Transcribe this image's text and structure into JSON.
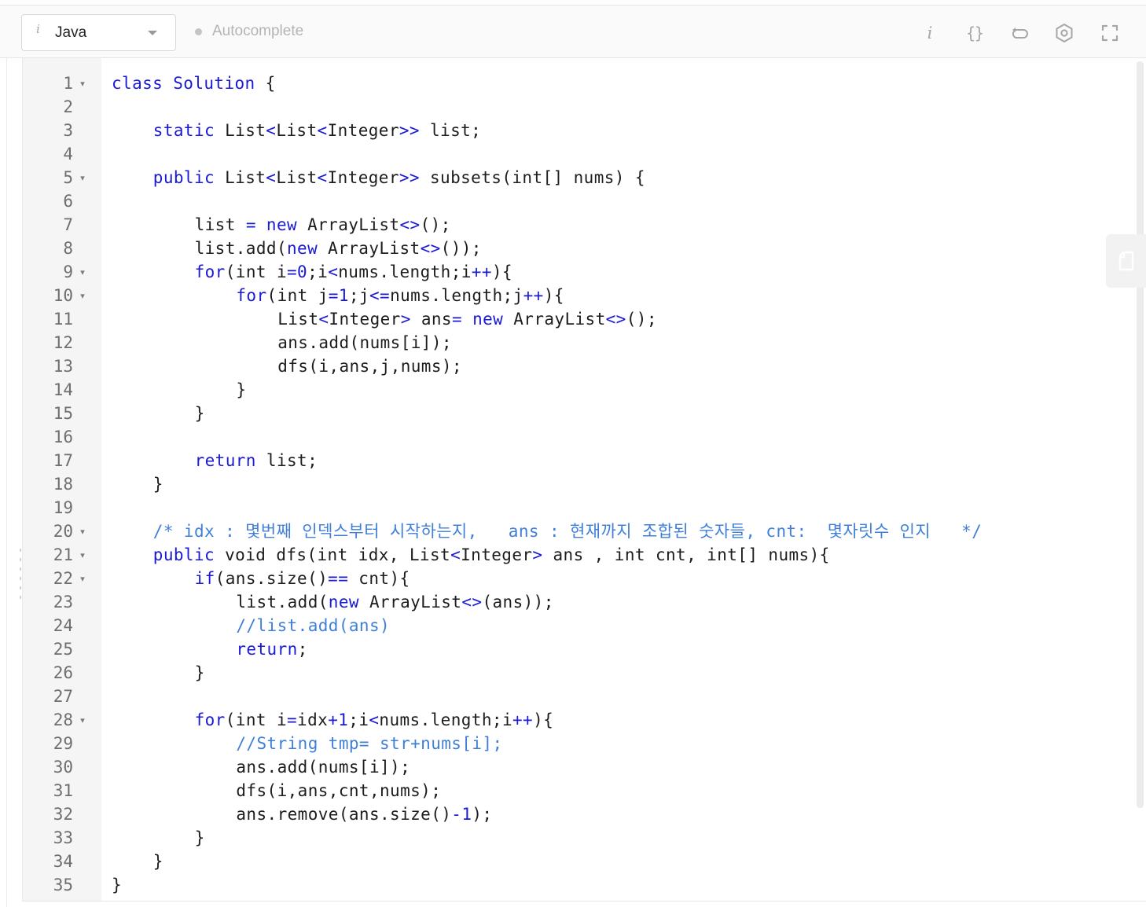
{
  "toolbar": {
    "language": "Java",
    "autocomplete_label": "Autocomplete",
    "icons": [
      "info-icon",
      "format-braces-icon",
      "reset-icon",
      "settings-icon",
      "fullscreen-icon"
    ],
    "info_glyph": "i",
    "braces_glyph": "{}"
  },
  "editor": {
    "lines": [
      {
        "n": "1",
        "fold": true,
        "indent": 0,
        "tokens": [
          [
            "kw",
            "class Solution "
          ],
          [
            "",
            "{"
          ]
        ]
      },
      {
        "n": "2",
        "fold": false,
        "indent": 0,
        "tokens": []
      },
      {
        "n": "3",
        "fold": false,
        "indent": 1,
        "tokens": [
          [
            "kw",
            "static"
          ],
          [
            "",
            " List"
          ],
          [
            "op",
            "<"
          ],
          [
            "",
            "List"
          ],
          [
            "op",
            "<"
          ],
          [
            "",
            "Integer"
          ],
          [
            "op",
            ">>"
          ],
          [
            "",
            " list;"
          ]
        ]
      },
      {
        "n": "4",
        "fold": false,
        "indent": 0,
        "tokens": []
      },
      {
        "n": "5",
        "fold": true,
        "indent": 1,
        "tokens": [
          [
            "kw",
            "public"
          ],
          [
            "",
            " List"
          ],
          [
            "op",
            "<"
          ],
          [
            "",
            "List"
          ],
          [
            "op",
            "<"
          ],
          [
            "",
            "Integer"
          ],
          [
            "op",
            ">>"
          ],
          [
            "",
            " subsets(int[] nums) {"
          ]
        ]
      },
      {
        "n": "6",
        "fold": false,
        "indent": 0,
        "tokens": []
      },
      {
        "n": "7",
        "fold": false,
        "indent": 2,
        "tokens": [
          [
            "",
            "list "
          ],
          [
            "op",
            "="
          ],
          [
            "",
            " "
          ],
          [
            "kw",
            "new"
          ],
          [
            "",
            " ArrayList"
          ],
          [
            "op",
            "<>"
          ],
          [
            "",
            "();"
          ]
        ]
      },
      {
        "n": "8",
        "fold": false,
        "indent": 2,
        "tokens": [
          [
            "",
            "list.add("
          ],
          [
            "kw",
            "new"
          ],
          [
            "",
            " ArrayList"
          ],
          [
            "op",
            "<>"
          ],
          [
            "",
            "());"
          ]
        ]
      },
      {
        "n": "9",
        "fold": true,
        "indent": 2,
        "tokens": [
          [
            "kw",
            "for"
          ],
          [
            "",
            "(int i"
          ],
          [
            "op",
            "="
          ],
          [
            "num",
            "0"
          ],
          [
            "",
            ";i"
          ],
          [
            "op",
            "<"
          ],
          [
            "",
            "nums.length;i"
          ],
          [
            "op",
            "++"
          ],
          [
            "",
            "){"
          ]
        ]
      },
      {
        "n": "10",
        "fold": true,
        "indent": 3,
        "tokens": [
          [
            "kw",
            "for"
          ],
          [
            "",
            "(int j"
          ],
          [
            "op",
            "="
          ],
          [
            "num",
            "1"
          ],
          [
            "",
            ";j"
          ],
          [
            "op",
            "<="
          ],
          [
            "",
            "nums.length;j"
          ],
          [
            "op",
            "++"
          ],
          [
            "",
            "){"
          ]
        ]
      },
      {
        "n": "11",
        "fold": false,
        "indent": 4,
        "tokens": [
          [
            "",
            "List"
          ],
          [
            "op",
            "<"
          ],
          [
            "",
            "Integer"
          ],
          [
            "op",
            ">"
          ],
          [
            "",
            " ans"
          ],
          [
            "op",
            "="
          ],
          [
            "",
            " "
          ],
          [
            "kw",
            "new"
          ],
          [
            "",
            " ArrayList"
          ],
          [
            "op",
            "<>"
          ],
          [
            "",
            "();"
          ]
        ]
      },
      {
        "n": "12",
        "fold": false,
        "indent": 4,
        "tokens": [
          [
            "",
            "ans.add(nums[i]);"
          ]
        ]
      },
      {
        "n": "13",
        "fold": false,
        "indent": 4,
        "tokens": [
          [
            "",
            "dfs(i,ans,j,nums);"
          ]
        ]
      },
      {
        "n": "14",
        "fold": false,
        "indent": 3,
        "tokens": [
          [
            "",
            "}"
          ]
        ]
      },
      {
        "n": "15",
        "fold": false,
        "indent": 2,
        "tokens": [
          [
            "",
            "}"
          ]
        ]
      },
      {
        "n": "16",
        "fold": false,
        "indent": 0,
        "tokens": []
      },
      {
        "n": "17",
        "fold": false,
        "indent": 2,
        "tokens": [
          [
            "kw",
            "return"
          ],
          [
            "",
            " list;"
          ]
        ]
      },
      {
        "n": "18",
        "fold": false,
        "indent": 1,
        "tokens": [
          [
            "",
            "}"
          ]
        ]
      },
      {
        "n": "19",
        "fold": false,
        "indent": 0,
        "tokens": []
      },
      {
        "n": "20",
        "fold": true,
        "indent": 1,
        "tokens": [
          [
            "cm",
            "/* idx : 몇번째 인덱스부터 시작하는지,   ans : 현재까지 조합된 숫자들, cnt:  몇자릿수 인지   */"
          ]
        ]
      },
      {
        "n": "21",
        "fold": true,
        "indent": 1,
        "tokens": [
          [
            "kw",
            "public"
          ],
          [
            "",
            " void dfs(int idx, List"
          ],
          [
            "op",
            "<"
          ],
          [
            "",
            "Integer"
          ],
          [
            "op",
            ">"
          ],
          [
            "",
            " ans , int cnt, int[] nums){"
          ]
        ]
      },
      {
        "n": "22",
        "fold": true,
        "indent": 2,
        "tokens": [
          [
            "kw",
            "if"
          ],
          [
            "",
            "(ans.size()"
          ],
          [
            "op",
            "=="
          ],
          [
            "",
            " cnt){"
          ]
        ]
      },
      {
        "n": "23",
        "fold": false,
        "indent": 3,
        "tokens": [
          [
            "",
            "list.add("
          ],
          [
            "kw",
            "new"
          ],
          [
            "",
            " ArrayList"
          ],
          [
            "op",
            "<>"
          ],
          [
            "",
            "(ans));"
          ]
        ]
      },
      {
        "n": "24",
        "fold": false,
        "indent": 3,
        "tokens": [
          [
            "cm",
            "//list.add(ans)"
          ]
        ]
      },
      {
        "n": "25",
        "fold": false,
        "indent": 3,
        "tokens": [
          [
            "kw",
            "return"
          ],
          [
            "",
            ";"
          ]
        ]
      },
      {
        "n": "26",
        "fold": false,
        "indent": 2,
        "tokens": [
          [
            "",
            "}"
          ]
        ]
      },
      {
        "n": "27",
        "fold": false,
        "indent": 0,
        "tokens": []
      },
      {
        "n": "28",
        "fold": true,
        "indent": 2,
        "tokens": [
          [
            "kw",
            "for"
          ],
          [
            "",
            "(int i"
          ],
          [
            "op",
            "="
          ],
          [
            "",
            "idx"
          ],
          [
            "op",
            "+"
          ],
          [
            "num",
            "1"
          ],
          [
            "",
            ";i"
          ],
          [
            "op",
            "<"
          ],
          [
            "",
            "nums.length;i"
          ],
          [
            "op",
            "++"
          ],
          [
            "",
            "){"
          ]
        ]
      },
      {
        "n": "29",
        "fold": false,
        "indent": 3,
        "tokens": [
          [
            "cm",
            "//String tmp= str+nums[i];"
          ]
        ]
      },
      {
        "n": "30",
        "fold": false,
        "indent": 3,
        "tokens": [
          [
            "",
            "ans.add(nums[i]);"
          ]
        ]
      },
      {
        "n": "31",
        "fold": false,
        "indent": 3,
        "tokens": [
          [
            "",
            "dfs(i,ans,cnt,nums);"
          ]
        ]
      },
      {
        "n": "32",
        "fold": false,
        "indent": 3,
        "tokens": [
          [
            "",
            "ans.remove(ans.size()"
          ],
          [
            "op",
            "-"
          ],
          [
            "num",
            "1"
          ],
          [
            "",
            ");"
          ]
        ]
      },
      {
        "n": "33",
        "fold": false,
        "indent": 2,
        "tokens": [
          [
            "",
            "}"
          ]
        ]
      },
      {
        "n": "34",
        "fold": false,
        "indent": 1,
        "tokens": [
          [
            "",
            "}"
          ]
        ]
      },
      {
        "n": "35",
        "fold": false,
        "indent": 0,
        "tokens": [
          [
            "",
            "}"
          ]
        ]
      }
    ]
  }
}
